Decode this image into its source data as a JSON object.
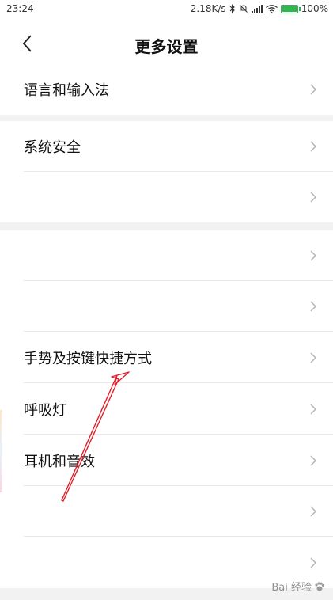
{
  "status_bar": {
    "time": "23:24",
    "net_speed": "2.18K/s",
    "battery": "100%"
  },
  "nav": {
    "title": "更多设置"
  },
  "rows": [
    {
      "label": "语言和输入法"
    },
    {
      "label": "系统安全"
    },
    {
      "label": ""
    },
    {
      "label": ""
    },
    {
      "label": ""
    },
    {
      "label": "手势及按键快捷方式"
    },
    {
      "label": "呼吸灯"
    },
    {
      "label": "耳机和音效"
    },
    {
      "label": ""
    },
    {
      "label": ""
    }
  ],
  "watermark": {
    "text": "Bai 经验"
  },
  "colors": {
    "arrow": "#e0202a",
    "battery": "#2db84d",
    "band": "#f2f2f2"
  },
  "icons": {
    "back": "chevron-left-icon",
    "row": "chevron-right-icon",
    "bluetooth": "bluetooth-icon",
    "mute": "bell-off-icon",
    "signal": "signal-icon",
    "wifi": "wifi-icon",
    "battery": "battery-icon"
  }
}
